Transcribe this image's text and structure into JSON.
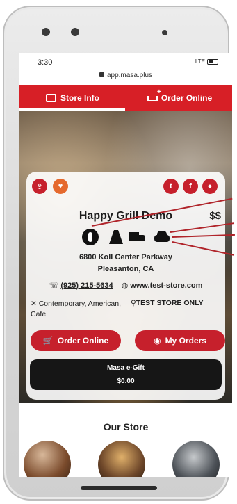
{
  "status": {
    "time": "3:30",
    "network": "LTE",
    "url": "app.masa.plus"
  },
  "tabs": [
    {
      "label": "Store Info"
    },
    {
      "label": "Order Online"
    }
  ],
  "store": {
    "name": "Happy Grill Demo",
    "price": "$$",
    "address_line1": "6800 Koll Center Parkway",
    "address_line2": "Pleasanton, CA",
    "phone": "(925) 215-5634",
    "website": "www.test-store.com",
    "cuisine": "Contemporary, American, Cafe",
    "tag": "TEST STORE ONLY"
  },
  "social": [
    "twitter-icon",
    "facebook-icon",
    "notification-icon"
  ],
  "services": [
    "dine-in-icon",
    "pickup-icon",
    "delivery-icon",
    "curbside-icon"
  ],
  "actions": {
    "order_online": "Order Online",
    "my_orders": "My Orders"
  },
  "gift": {
    "name": "Masa e-Gift",
    "amount": "$0.00"
  },
  "section_title": "Our Store",
  "colors": {
    "brand_red": "#d71f26",
    "card_red": "#c6202c",
    "heart_orange": "#e5692d"
  }
}
